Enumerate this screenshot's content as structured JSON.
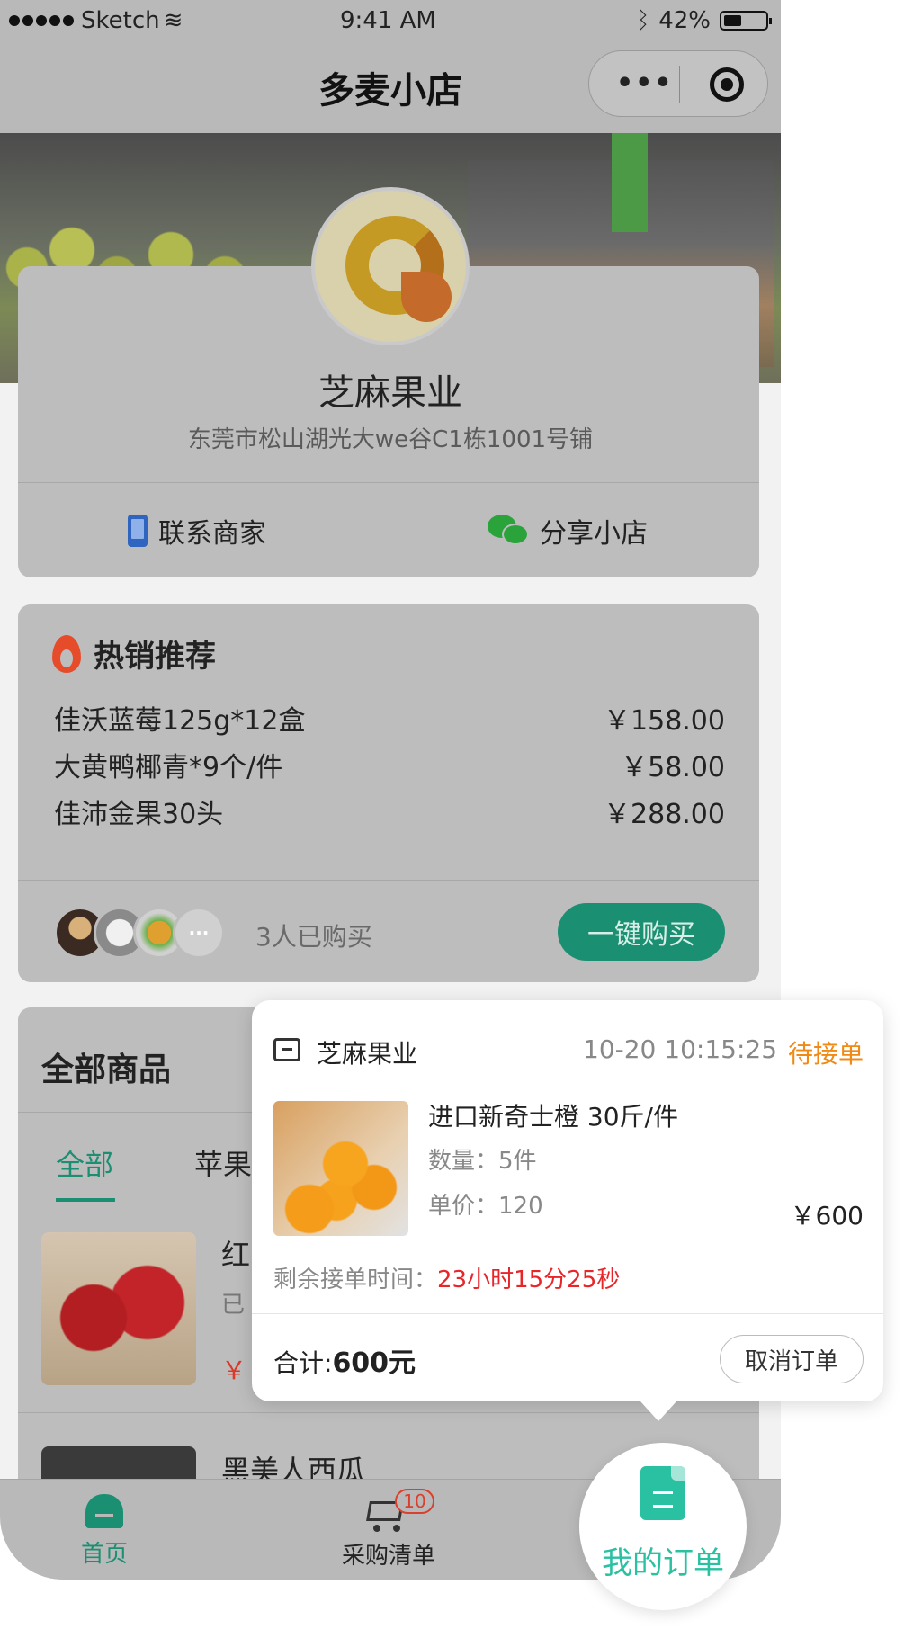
{
  "status_bar": {
    "carrier": "Sketch",
    "time": "9:41 AM",
    "battery": "42%"
  },
  "nav": {
    "title": "多麦小店",
    "more_icon": "more-dots-icon",
    "close_icon": "target-circle-icon"
  },
  "shop": {
    "name": "芝麻果业",
    "address": "东莞市松山湖光大we谷C1栋1001号铺",
    "contact_label": "联系商家",
    "share_label": "分享小店"
  },
  "hot": {
    "title": "热销推荐",
    "items": [
      {
        "name": "佳沃蓝莓125g*12盒",
        "price": "￥158.00"
      },
      {
        "name": "大黄鸭椰青*9个/件",
        "price": "￥58.00"
      },
      {
        "name": "佳沛金果30头",
        "price": "￥288.00"
      }
    ],
    "more_avatars": "···",
    "bought_text": "3人已购买",
    "buy_button": "一键购买"
  },
  "goods": {
    "title": "全部商品",
    "tabs": [
      "全部",
      "苹果"
    ],
    "products": [
      {
        "name_visible": "红",
        "sold_visible": "已",
        "price_visible": "￥"
      },
      {
        "name": "黑美人西瓜"
      }
    ]
  },
  "tabbar": {
    "home": "首页",
    "cart": "采购清单",
    "cart_badge": "10",
    "orders": "我的订单"
  },
  "popup": {
    "store": "芝麻果业",
    "time": "10-20 10:15:25",
    "status": "待接单",
    "product_name": "进口新奇士橙 30斤/件",
    "quantity": "数量：5件",
    "unit_price": "单价：120",
    "amount": "￥600",
    "remain_label": "剩余接单时间：",
    "remain_value": "23小时15分25秒",
    "total_label": "合计:",
    "total_value": "600元",
    "cancel_button": "取消订单"
  },
  "colors": {
    "accent_green": "#1b8f72",
    "fab_teal": "#29c1a2",
    "status_orange": "#f08a14",
    "countdown_red": "#e8262a"
  }
}
